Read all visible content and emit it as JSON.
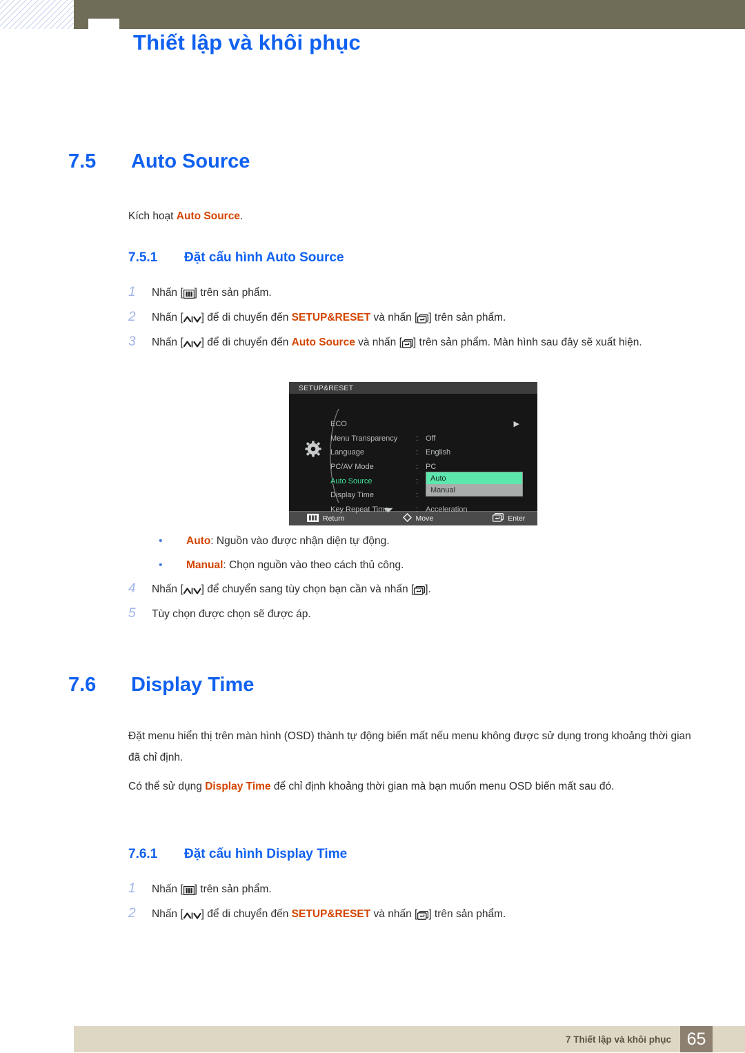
{
  "header": {
    "title": "Thiết lập và khôi phục"
  },
  "sections": [
    {
      "number": "7.5",
      "title": "Auto Source",
      "intro_before": "Kích hoạt ",
      "intro_strong": "Auto Source",
      "intro_after": ".",
      "sub_number": "7.5.1",
      "sub_title": "Đặt cấu hình Auto Source"
    },
    {
      "number": "7.6",
      "title": "Display Time",
      "sub_number": "7.6.1",
      "sub_title": "Đặt cấu hình Display Time"
    }
  ],
  "steps_auto_source": [
    {
      "marker": "1",
      "a": "Nhấn [",
      "icon1": "menu-key-icon",
      "b": "] trên sản phẩm.",
      "c": "",
      "d": "",
      "e": ""
    },
    {
      "marker": "2",
      "a": "Nhấn [",
      "icon1": "up-down-key-icon",
      "b": "] để di chuyển đến ",
      "strong": "SETUP&RESET",
      "c": " và nhấn [",
      "icon2": "enter-key-icon",
      "d": "] trên sản phẩm.",
      "e": ""
    },
    {
      "marker": "3",
      "a": "Nhấn [",
      "icon1": "up-down-key-icon",
      "b": "] để di chuyển đến ",
      "strong": "Auto Source",
      "c": " và nhấn [",
      "icon2": "enter-key-icon",
      "d": "] trên sản phẩm. Màn hình sau đây sẽ xuất hiện.",
      "e": ""
    }
  ],
  "steps_auto_source_tail": [
    {
      "marker": "4",
      "a": "Nhấn [",
      "icon1": "up-down-key-icon",
      "b": "] để chuyển sang tùy chọn bạn cần và nhấn [",
      "icon2": "enter-key-icon",
      "c": "]."
    },
    {
      "marker": "5",
      "a": "Tùy chọn được chọn sẽ được áp.",
      "b": "",
      "c": ""
    }
  ],
  "steps_display_time": [
    {
      "marker": "1",
      "a": "Nhấn [",
      "icon1": "menu-key-icon",
      "b": "] trên sản phẩm.",
      "c": "",
      "d": ""
    },
    {
      "marker": "2",
      "a": "Nhấn [",
      "icon1": "up-down-key-icon",
      "b": "] để di chuyển đến ",
      "strong": "SETUP&RESET",
      "c": " và nhấn [",
      "icon2": "enter-key-icon",
      "d": "] trên sản phẩm."
    }
  ],
  "bullets": [
    {
      "term": "Auto",
      "desc": ": Nguồn vào được nhận diện tự động."
    },
    {
      "term": "Manual",
      "desc": ": Chọn nguồn vào theo cách thủ công."
    }
  ],
  "display_time_paragraphs": {
    "p1": "Đặt menu hiển thị trên màn hình (OSD) thành tự động biến mất nếu menu không được sử dụng trong khoảng thời gian đã chỉ định.",
    "p2_before": "Có thể sử dụng ",
    "p2_strong": "Display Time",
    "p2_after": " để chỉ định khoảng thời gian mà bạn muốn menu OSD biến mất sau đó."
  },
  "osd": {
    "title": "SETUP&RESET",
    "rows": [
      {
        "label": "ECO",
        "colon": "",
        "value": "",
        "arrow": "▶",
        "active": false
      },
      {
        "label": "Menu Transparency",
        "colon": ":",
        "value": "Off",
        "arrow": "",
        "active": false
      },
      {
        "label": "Language",
        "colon": ":",
        "value": "English",
        "arrow": "",
        "active": false
      },
      {
        "label": "PC/AV Mode",
        "colon": ":",
        "value": "PC",
        "arrow": "",
        "active": false
      },
      {
        "label": "Auto Source",
        "colon": ":",
        "value": "",
        "arrow": "",
        "active": true
      },
      {
        "label": "Display Time",
        "colon": ":",
        "value": "",
        "arrow": "",
        "active": false
      },
      {
        "label": "Key Repeat Time",
        "colon": ":",
        "value": "Acceleration",
        "arrow": "",
        "active": false
      }
    ],
    "dropdown": [
      {
        "label": "Auto",
        "selected": true
      },
      {
        "label": "Manual",
        "selected": false
      }
    ],
    "footer": [
      {
        "icon": "menu-key-icon",
        "label": "Return"
      },
      {
        "icon": "diamond-move-icon",
        "label": "Move"
      },
      {
        "icon": "enter-key-icon",
        "label": "Enter"
      }
    ]
  },
  "footer": {
    "label": "7 Thiết lập và khôi phục",
    "page": "65"
  },
  "colors": {
    "heading_blue": "#1061f0",
    "accent_orange": "#d44500",
    "olive": "#6f6d57",
    "footer_beige": "#ddd7c4",
    "footer_page_box": "#8d8070",
    "osd_highlight": "#5ce8ad",
    "osd_active_label": "#3fe39a"
  }
}
